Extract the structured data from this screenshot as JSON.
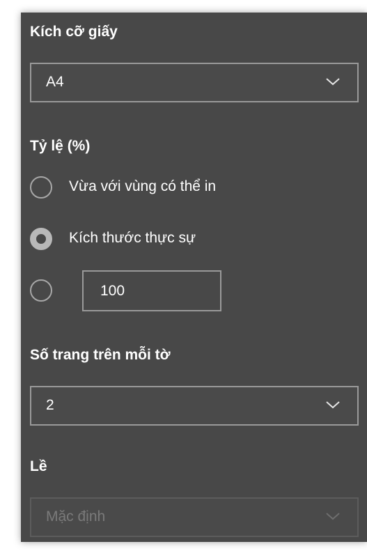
{
  "paper_size": {
    "label": "Kích cỡ giấy",
    "selected": "A4",
    "icon": "chevron-down-icon"
  },
  "scale": {
    "label": "Tỷ lệ (%)",
    "options": [
      {
        "label": "Vừa với vùng có thể in",
        "checked": false
      },
      {
        "label": "Kích thước thực sự",
        "checked": true
      },
      {
        "label": "",
        "checked": false
      }
    ],
    "custom_value": "100"
  },
  "pages_per_sheet": {
    "label": "Số trang trên mỗi tờ",
    "selected": "2",
    "icon": "chevron-down-icon"
  },
  "margins": {
    "label": "Lề",
    "selected": "Mặc định",
    "disabled": true,
    "icon": "chevron-down-icon"
  },
  "colors": {
    "panel_bg": "#484848",
    "text": "#ffffff",
    "border": "#9a9a9a",
    "disabled_text": "#7a7a7a"
  }
}
